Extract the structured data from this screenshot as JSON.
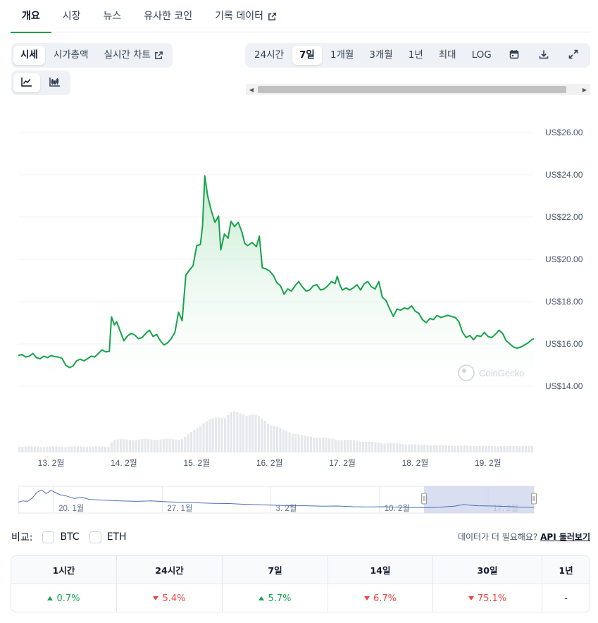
{
  "top_tabs": [
    {
      "label": "개요",
      "active": true
    },
    {
      "label": "시장"
    },
    {
      "label": "뉴스"
    },
    {
      "label": "유사한 코인"
    },
    {
      "label": "기록 데이터"
    }
  ],
  "view_tabs": [
    {
      "label": "시세",
      "active": true
    },
    {
      "label": "시가총액"
    },
    {
      "label": "실시간 차트"
    }
  ],
  "range_tabs": [
    {
      "label": "24시간"
    },
    {
      "label": "7일",
      "active": true
    },
    {
      "label": "1개월"
    },
    {
      "label": "3개월"
    },
    {
      "label": "1년"
    },
    {
      "label": "최대"
    },
    {
      "label": "LOG"
    }
  ],
  "icons": {
    "calendar": "calendar-icon",
    "download": "download-icon",
    "expand": "expand-icon",
    "line_chart": "line-chart-icon",
    "candle_chart": "candlestick-chart-icon",
    "external": "external-link-icon"
  },
  "colors": {
    "accent": "#16a34a",
    "line": "#16a34a",
    "fill_top": "#d1f0da",
    "volume": "#e5e7eb",
    "navigator_line": "#4a6fb5",
    "navigator_window": "#cfd6ee",
    "up": "#16a34a",
    "down": "#ef4444"
  },
  "chart_data": {
    "type": "area",
    "y_unit_prefix": "US$",
    "ylim": [
      14,
      26
    ],
    "yticks": [
      "US$26.00",
      "US$24.00",
      "US$22.00",
      "US$20.00",
      "US$18.00",
      "US$16.00",
      "US$14.00"
    ],
    "yticks_values": [
      26,
      24,
      22,
      20,
      18,
      16,
      14
    ],
    "xticks": [
      "13. 2월",
      "14. 2월",
      "15. 2월",
      "16. 2월",
      "17. 2월",
      "18. 2월",
      "19. 2월"
    ],
    "x_range_days": [
      12.55,
      19.63
    ],
    "grid": true,
    "watermark": "CoinGecko",
    "price_series": [
      [
        12.55,
        15.45
      ],
      [
        12.6,
        15.5
      ],
      [
        12.65,
        15.38
      ],
      [
        12.7,
        15.42
      ],
      [
        12.75,
        15.55
      ],
      [
        12.8,
        15.35
      ],
      [
        12.85,
        15.3
      ],
      [
        12.9,
        15.42
      ],
      [
        12.95,
        15.35
      ],
      [
        13.0,
        15.45
      ],
      [
        13.05,
        15.4
      ],
      [
        13.1,
        15.38
      ],
      [
        13.15,
        15.32
      ],
      [
        13.2,
        15.0
      ],
      [
        13.25,
        14.88
      ],
      [
        13.3,
        14.95
      ],
      [
        13.35,
        15.2
      ],
      [
        13.4,
        15.28
      ],
      [
        13.45,
        15.2
      ],
      [
        13.5,
        15.3
      ],
      [
        13.55,
        15.42
      ],
      [
        13.6,
        15.38
      ],
      [
        13.65,
        15.55
      ],
      [
        13.7,
        15.72
      ],
      [
        13.75,
        15.62
      ],
      [
        13.8,
        15.65
      ],
      [
        13.83,
        17.28
      ],
      [
        13.87,
        16.9
      ],
      [
        13.9,
        17.05
      ],
      [
        13.95,
        16.6
      ],
      [
        14.0,
        16.15
      ],
      [
        14.05,
        16.38
      ],
      [
        14.1,
        16.5
      ],
      [
        14.15,
        16.42
      ],
      [
        14.2,
        16.25
      ],
      [
        14.25,
        16.3
      ],
      [
        14.3,
        16.5
      ],
      [
        14.35,
        16.65
      ],
      [
        14.4,
        16.35
      ],
      [
        14.45,
        16.45
      ],
      [
        14.5,
        16.15
      ],
      [
        14.55,
        15.95
      ],
      [
        14.6,
        16.05
      ],
      [
        14.65,
        16.25
      ],
      [
        14.7,
        16.55
      ],
      [
        14.75,
        17.5
      ],
      [
        14.8,
        17.1
      ],
      [
        14.85,
        19.25
      ],
      [
        14.9,
        19.5
      ],
      [
        14.95,
        19.7
      ],
      [
        15.0,
        20.65
      ],
      [
        15.05,
        20.7
      ],
      [
        15.08,
        21.6
      ],
      [
        15.11,
        23.95
      ],
      [
        15.15,
        23.0
      ],
      [
        15.2,
        22.3
      ],
      [
        15.25,
        21.75
      ],
      [
        15.3,
        22.05
      ],
      [
        15.33,
        20.45
      ],
      [
        15.38,
        21.2
      ],
      [
        15.43,
        21.0
      ],
      [
        15.47,
        21.8
      ],
      [
        15.52,
        21.55
      ],
      [
        15.57,
        21.75
      ],
      [
        15.62,
        21.3
      ],
      [
        15.66,
        20.75
      ],
      [
        15.7,
        20.65
      ],
      [
        15.76,
        20.8
      ],
      [
        15.82,
        20.6
      ],
      [
        15.86,
        21.1
      ],
      [
        15.9,
        19.6
      ],
      [
        15.95,
        19.55
      ],
      [
        16.0,
        19.45
      ],
      [
        16.05,
        19.25
      ],
      [
        16.1,
        18.9
      ],
      [
        16.15,
        18.75
      ],
      [
        16.2,
        18.35
      ],
      [
        16.25,
        18.6
      ],
      [
        16.3,
        18.5
      ],
      [
        16.35,
        18.75
      ],
      [
        16.4,
        18.95
      ],
      [
        16.45,
        18.7
      ],
      [
        16.5,
        18.5
      ],
      [
        16.55,
        18.55
      ],
      [
        16.6,
        18.75
      ],
      [
        16.65,
        18.8
      ],
      [
        16.7,
        18.55
      ],
      [
        16.75,
        18.6
      ],
      [
        16.8,
        18.75
      ],
      [
        16.85,
        18.95
      ],
      [
        16.9,
        18.85
      ],
      [
        16.93,
        19.2
      ],
      [
        16.97,
        18.75
      ],
      [
        17.0,
        18.55
      ],
      [
        17.05,
        18.65
      ],
      [
        17.1,
        18.55
      ],
      [
        17.15,
        18.65
      ],
      [
        17.2,
        18.8
      ],
      [
        17.25,
        18.55
      ],
      [
        17.3,
        18.85
      ],
      [
        17.35,
        18.95
      ],
      [
        17.4,
        18.7
      ],
      [
        17.45,
        18.6
      ],
      [
        17.5,
        18.95
      ],
      [
        17.55,
        18.2
      ],
      [
        17.6,
        18.05
      ],
      [
        17.65,
        17.65
      ],
      [
        17.7,
        17.3
      ],
      [
        17.75,
        17.65
      ],
      [
        17.8,
        17.6
      ],
      [
        17.85,
        17.7
      ],
      [
        17.9,
        17.65
      ],
      [
        17.95,
        17.8
      ],
      [
        18.0,
        17.55
      ],
      [
        18.05,
        17.45
      ],
      [
        18.1,
        17.15
      ],
      [
        18.15,
        17.0
      ],
      [
        18.2,
        17.2
      ],
      [
        18.25,
        17.15
      ],
      [
        18.3,
        17.35
      ],
      [
        18.35,
        17.25
      ],
      [
        18.4,
        17.3
      ],
      [
        18.45,
        17.35
      ],
      [
        18.5,
        17.3
      ],
      [
        18.55,
        17.25
      ],
      [
        18.6,
        17.05
      ],
      [
        18.65,
        16.55
      ],
      [
        18.7,
        16.3
      ],
      [
        18.75,
        16.4
      ],
      [
        18.8,
        16.2
      ],
      [
        18.85,
        16.4
      ],
      [
        18.9,
        16.35
      ],
      [
        18.95,
        16.55
      ],
      [
        19.0,
        16.35
      ],
      [
        19.05,
        16.3
      ],
      [
        19.1,
        16.45
      ],
      [
        19.15,
        16.65
      ],
      [
        19.2,
        16.5
      ],
      [
        19.25,
        16.15
      ],
      [
        19.3,
        16.0
      ],
      [
        19.35,
        15.85
      ],
      [
        19.4,
        15.8
      ],
      [
        19.45,
        15.85
      ],
      [
        19.5,
        15.95
      ],
      [
        19.55,
        16.05
      ],
      [
        19.6,
        16.2
      ],
      [
        19.63,
        16.25
      ]
    ],
    "volume_shape": [
      [
        12.55,
        0.12
      ],
      [
        13.8,
        0.12
      ],
      [
        13.85,
        0.26
      ],
      [
        14.8,
        0.27
      ],
      [
        14.85,
        0.32
      ],
      [
        15.0,
        0.48
      ],
      [
        15.1,
        0.62
      ],
      [
        15.4,
        0.75
      ],
      [
        15.5,
        0.82
      ],
      [
        15.6,
        0.78
      ],
      [
        15.7,
        0.8
      ],
      [
        15.8,
        0.76
      ],
      [
        16.0,
        0.6
      ],
      [
        16.2,
        0.45
      ],
      [
        16.5,
        0.33
      ],
      [
        17.0,
        0.26
      ],
      [
        17.5,
        0.2
      ],
      [
        18.0,
        0.16
      ],
      [
        18.5,
        0.14
      ],
      [
        19.0,
        0.13
      ],
      [
        19.63,
        0.13
      ]
    ],
    "navigator": {
      "labels": [
        "20. 1월",
        "27. 1월",
        "3. 2월",
        "10. 2월",
        "17. 2월"
      ],
      "label_days": [
        -11.3,
        -4.3,
        2.7,
        9.7,
        16.7
      ],
      "range_days": [
        -13.6,
        19.63
      ],
      "window_days": [
        12.55,
        19.63
      ],
      "shape": [
        [
          -13.6,
          18.5
        ],
        [
          -13.3,
          19.0
        ],
        [
          -13.0,
          18.8
        ],
        [
          -12.7,
          20.2
        ],
        [
          -12.4,
          22.5
        ],
        [
          -12.1,
          23.5
        ],
        [
          -11.8,
          22.0
        ],
        [
          -11.5,
          23.3
        ],
        [
          -11.2,
          22.4
        ],
        [
          -10.9,
          21.5
        ],
        [
          -10.5,
          21.0
        ],
        [
          -10.0,
          20.0
        ],
        [
          -9.5,
          20.5
        ],
        [
          -9.0,
          19.6
        ],
        [
          -8.0,
          19.3
        ],
        [
          -7.0,
          19.0
        ],
        [
          -6.0,
          18.8
        ],
        [
          -5.0,
          19.0
        ],
        [
          -4.0,
          18.6
        ],
        [
          -3.0,
          18.4
        ],
        [
          -2.0,
          18.2
        ],
        [
          -1.0,
          18.0
        ],
        [
          0.0,
          17.9
        ],
        [
          1.0,
          17.6
        ],
        [
          2.0,
          17.4
        ],
        [
          3.0,
          17.2
        ],
        [
          4.0,
          17.0
        ],
        [
          5.0,
          17.0
        ],
        [
          6.0,
          16.8
        ],
        [
          7.0,
          16.9
        ],
        [
          8.0,
          16.6
        ],
        [
          9.0,
          16.5
        ],
        [
          10.0,
          16.6
        ],
        [
          11.0,
          16.4
        ],
        [
          12.0,
          16.3
        ],
        [
          12.55,
          16.2
        ],
        [
          13.5,
          16.4
        ],
        [
          14.5,
          16.8
        ],
        [
          15.1,
          17.5
        ],
        [
          15.5,
          17.2
        ],
        [
          16.0,
          17.0
        ],
        [
          17.0,
          16.9
        ],
        [
          18.0,
          16.7
        ],
        [
          19.0,
          16.4
        ],
        [
          19.63,
          16.35
        ]
      ]
    }
  },
  "compare": {
    "label": "비교:",
    "options": [
      "BTC",
      "ETH"
    ]
  },
  "need_more": {
    "text": "데이터가 더 필요해요?",
    "link": "API 둘러보기"
  },
  "performance": {
    "headers": [
      "1시간",
      "24시간",
      "7일",
      "14일",
      "30일",
      "1년"
    ],
    "values": [
      {
        "text": "0.7%",
        "dir": "up"
      },
      {
        "text": "5.4%",
        "dir": "down"
      },
      {
        "text": "5.7%",
        "dir": "up"
      },
      {
        "text": "6.7%",
        "dir": "down"
      },
      {
        "text": "75.1%",
        "dir": "down"
      },
      {
        "text": "-",
        "dir": "none"
      }
    ]
  }
}
